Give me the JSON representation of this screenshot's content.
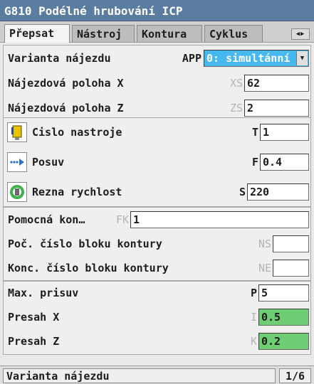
{
  "window": {
    "title": "G810 Podélné hrubování ICP"
  },
  "tabs": [
    {
      "label": "Přepsat",
      "active": true
    },
    {
      "label": "Nástroj",
      "active": false
    },
    {
      "label": "Kontura",
      "active": false
    },
    {
      "label": "Cyklus",
      "active": false
    }
  ],
  "approach": {
    "variant": {
      "label": "Varianta nájezdu",
      "address": "APP",
      "value": "0: simultánní"
    },
    "pos_x": {
      "label": "Nájezdová poloha X",
      "address": "XS",
      "value": "62"
    },
    "pos_z": {
      "label": "Nájezdová poloha Z",
      "address": "ZS",
      "value": "2"
    }
  },
  "tool": {
    "number": {
      "label": "Cislo nastroje",
      "address": "T",
      "value": "1",
      "icon": "tool-holder-icon"
    },
    "feed": {
      "label": "Posuv",
      "address": "F",
      "value": "0.4",
      "icon": "feed-arrow-icon"
    },
    "speed": {
      "label": "Rezna rychlost",
      "address": "S",
      "value": "220",
      "icon": "spindle-speed-icon"
    }
  },
  "contour": {
    "aux": {
      "label": "Pomocná kon…",
      "address": "FK",
      "value": "1"
    },
    "start_block": {
      "label": "Poč. číslo bloku kontury",
      "address": "NS",
      "value": ""
    },
    "end_block": {
      "label": "Konc. číslo bloku kontury",
      "address": "NE",
      "value": ""
    }
  },
  "cycle": {
    "max_infeed": {
      "label": "Max. prisuv",
      "address": "P",
      "value": "5"
    },
    "allow_x": {
      "label": "Presah X",
      "address": "I",
      "value": "0.5"
    },
    "allow_z": {
      "label": "Presah Z",
      "address": "K",
      "value": "0.2"
    }
  },
  "status": {
    "text": "Varianta nájezdu",
    "page": "1/6"
  },
  "colors": {
    "title_bar": "#5a7ca0",
    "selected_field": "#45b8f0",
    "highlight_field": "#6fce73"
  }
}
